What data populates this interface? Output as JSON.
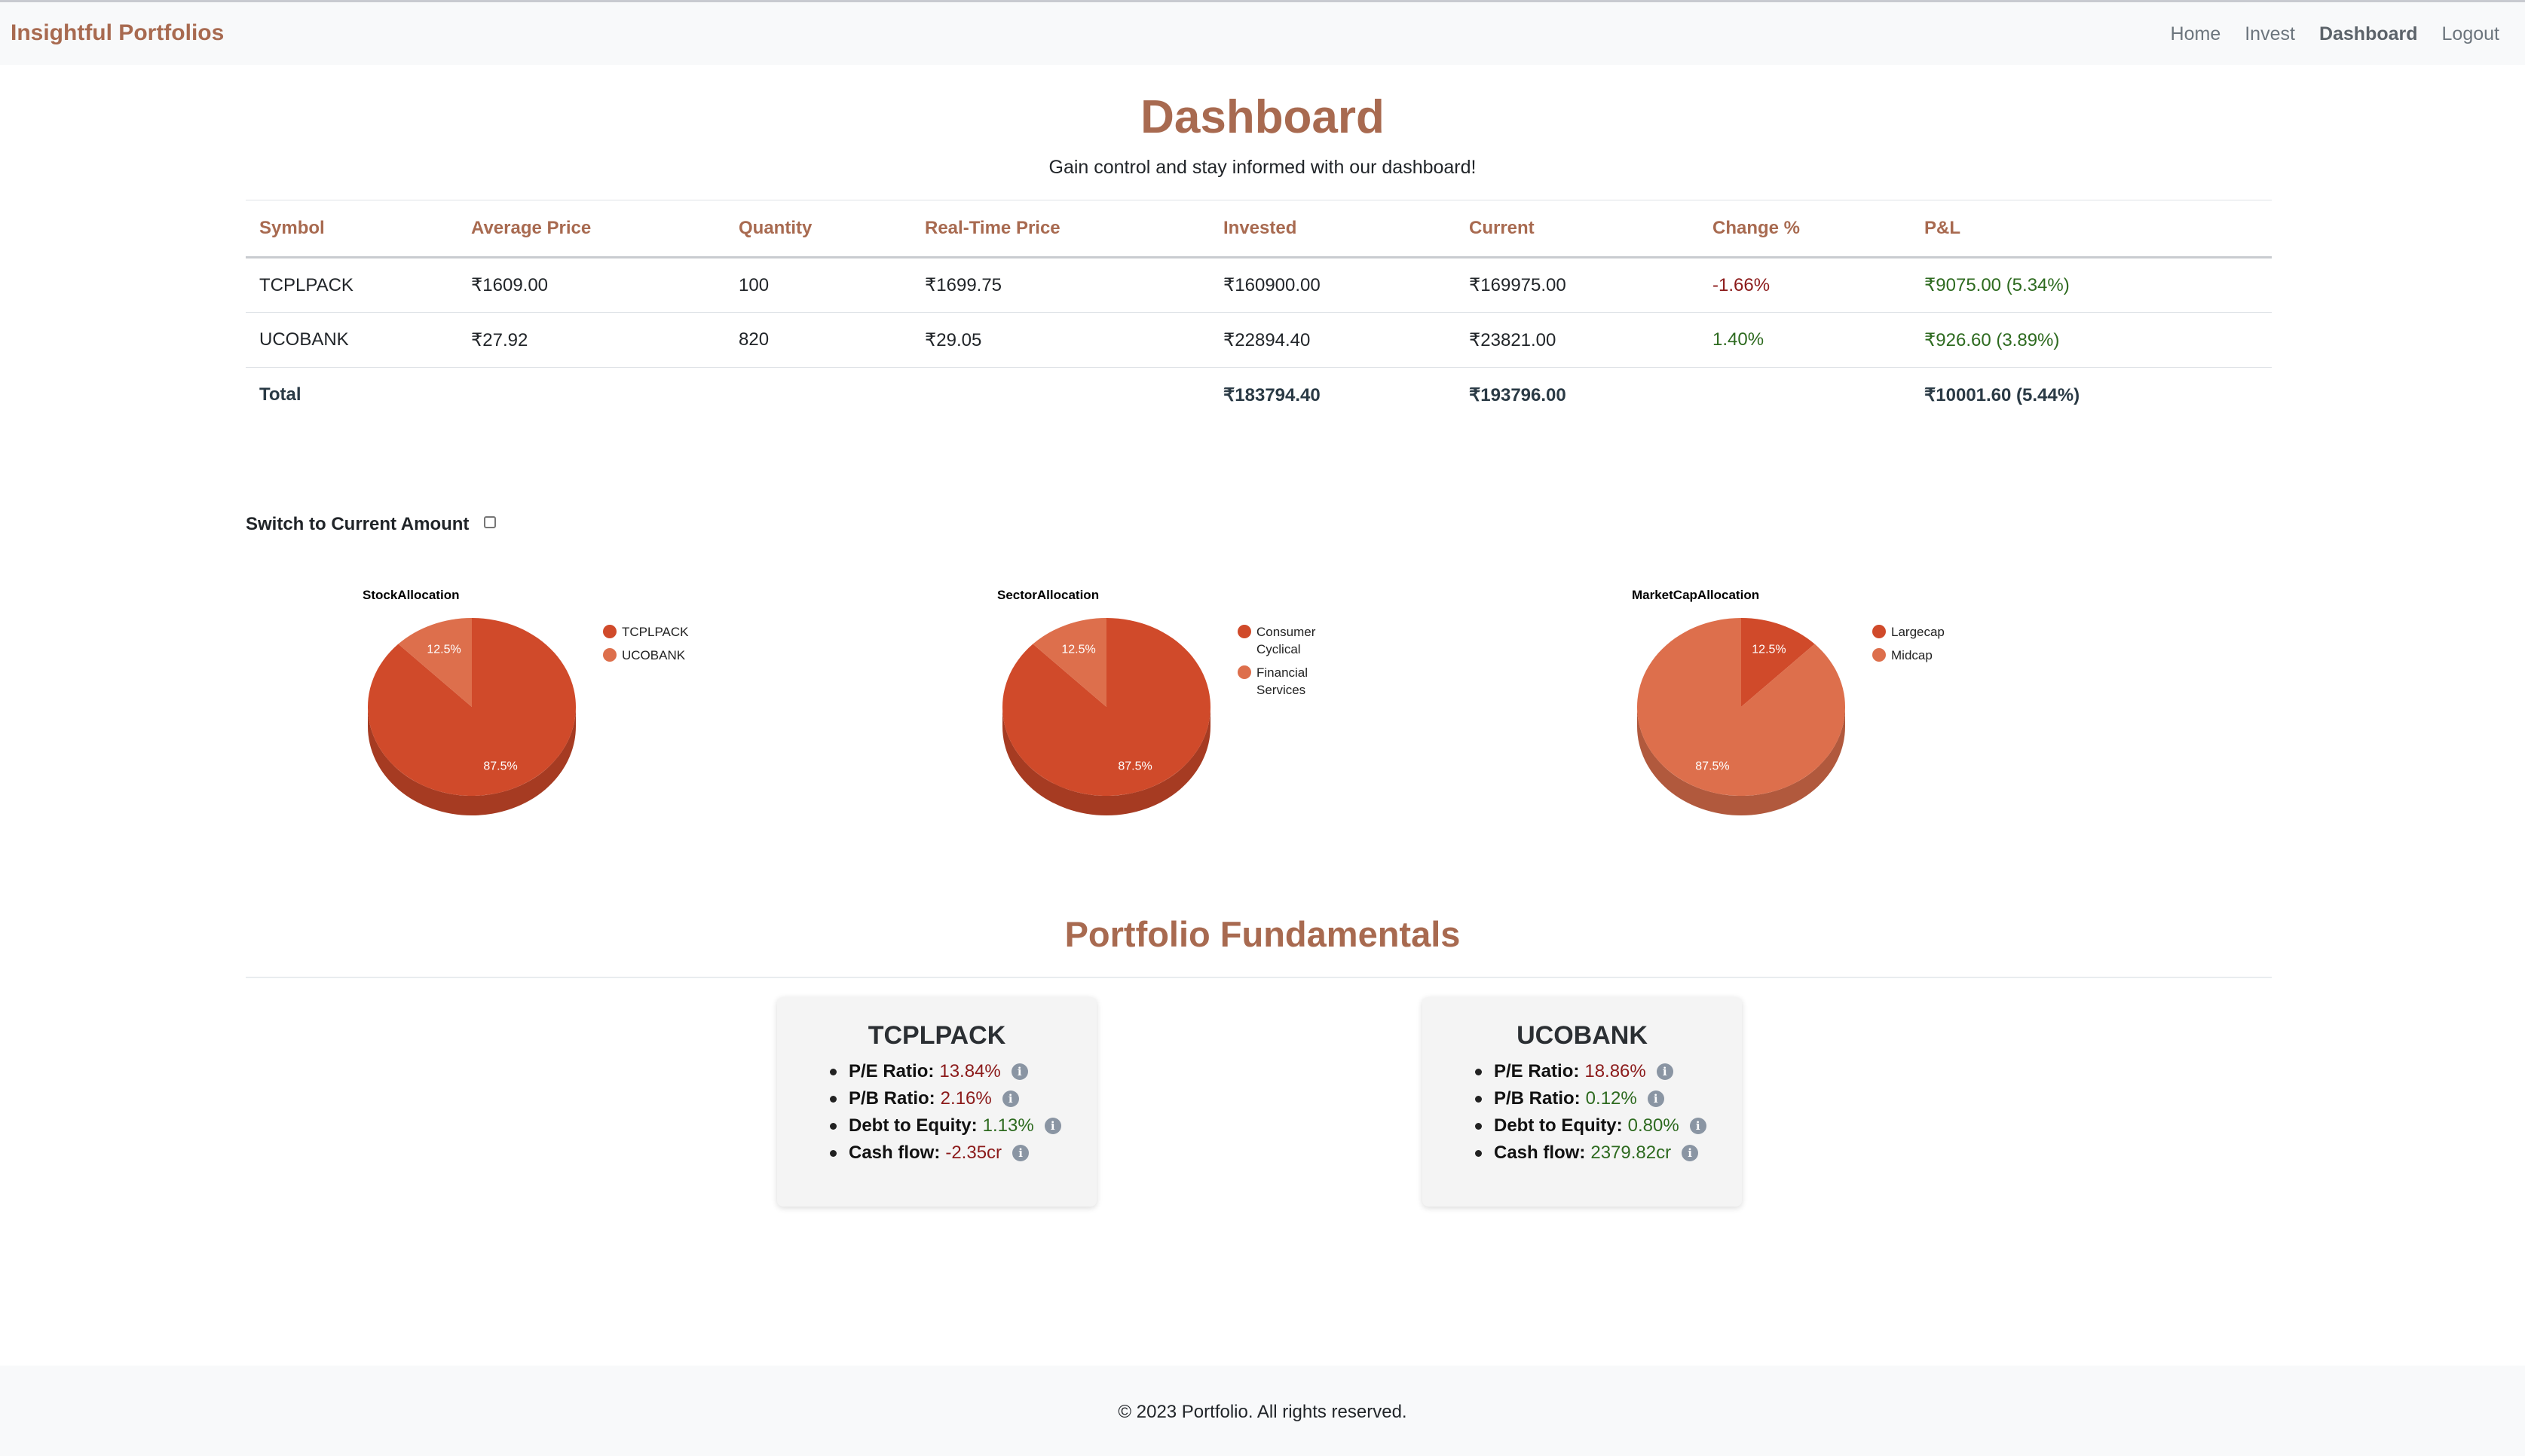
{
  "navbar": {
    "brand": "Insightful Portfolios",
    "links": [
      "Home",
      "Invest",
      "Dashboard",
      "Logout"
    ]
  },
  "header": {
    "title": "Dashboard",
    "subtitle": "Gain control and stay informed with our dashboard!"
  },
  "table": {
    "columns": [
      "Symbol",
      "Average Price",
      "Quantity",
      "Real-Time Price",
      "Invested",
      "Current",
      "Change %",
      "P&L"
    ],
    "rows": [
      {
        "symbol": "TCPLPACK",
        "avg_price": "₹1609.00",
        "quantity": "100",
        "rt_price": "₹1699.75",
        "invested": "₹160900.00",
        "current": "₹169975.00",
        "change": "-1.66%",
        "pnl": "₹9075.00 (5.34%)"
      },
      {
        "symbol": "UCOBANK",
        "avg_price": "₹27.92",
        "quantity": "820",
        "rt_price": "₹29.05",
        "invested": "₹22894.40",
        "current": "₹23821.00",
        "change": "1.40%",
        "pnl": "₹926.60 (3.89%)"
      }
    ],
    "total": {
      "label": "Total",
      "invested": "₹183794.40",
      "current": "₹193796.00",
      "pnl": "₹10001.60 (5.44%)"
    }
  },
  "switch": {
    "label": "Switch to Current Amount",
    "checked": false
  },
  "chart_data": [
    {
      "type": "pie",
      "title": "StockAllocation",
      "categories": [
        "TCPLPACK",
        "UCOBANK"
      ],
      "values": [
        87.5,
        12.5
      ],
      "labels": [
        "87.5%",
        "12.5%"
      ],
      "colors": [
        "#d04a2a",
        "#dd6f4c"
      ],
      "legend_lines": [
        [
          "TCPLPACK"
        ],
        [
          "UCOBANK"
        ]
      ],
      "legend": "right"
    },
    {
      "type": "pie",
      "title": "SectorAllocation",
      "categories": [
        "Consumer Cyclical",
        "Financial Services"
      ],
      "values": [
        87.5,
        12.5
      ],
      "labels": [
        "87.5%",
        "12.5%"
      ],
      "colors": [
        "#d04a2a",
        "#dd6f4c"
      ],
      "legend_lines": [
        [
          "Consumer",
          "Cyclical"
        ],
        [
          "Financial",
          "Services"
        ]
      ],
      "legend": "right"
    },
    {
      "type": "pie",
      "title": "MarketCapAllocation",
      "categories": [
        "Largecap",
        "Midcap"
      ],
      "values": [
        12.5,
        87.5
      ],
      "labels": [
        "12.5%",
        "87.5%"
      ],
      "colors": [
        "#d04a2a",
        "#dd6f4c"
      ],
      "legend_lines": [
        [
          "Largecap"
        ],
        [
          "Midcap"
        ]
      ],
      "legend": "right"
    }
  ],
  "fundamentals": {
    "title": "Portfolio Fundamentals",
    "cards": [
      {
        "symbol": "TCPLPACK",
        "metrics": [
          {
            "label": "P/E Ratio:",
            "value": "13.84%",
            "tone": "neg"
          },
          {
            "label": "P/B Ratio:",
            "value": "2.16%",
            "tone": "neg"
          },
          {
            "label": "Debt to Equity:",
            "value": "1.13%",
            "tone": "pos"
          },
          {
            "label": "Cash flow:",
            "value": "-2.35cr",
            "tone": "neg"
          }
        ]
      },
      {
        "symbol": "UCOBANK",
        "metrics": [
          {
            "label": "P/E Ratio:",
            "value": "18.86%",
            "tone": "neg"
          },
          {
            "label": "P/B Ratio:",
            "value": "0.12%",
            "tone": "pos"
          },
          {
            "label": "Debt to Equity:",
            "value": "0.80%",
            "tone": "pos"
          },
          {
            "label": "Cash flow:",
            "value": "2379.82cr",
            "tone": "pos"
          }
        ]
      }
    ],
    "info_icon": "i"
  },
  "footer": {
    "text": "© 2023 Portfolio. All rights reserved."
  }
}
